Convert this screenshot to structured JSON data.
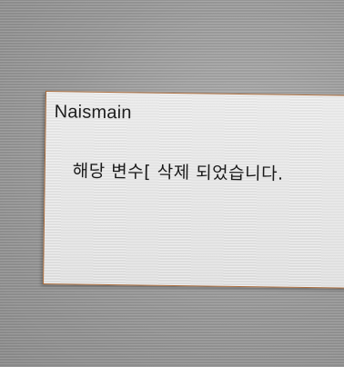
{
  "dialog": {
    "title": "Naismain",
    "message": "해당 변수[ 삭제 되었습니다."
  }
}
